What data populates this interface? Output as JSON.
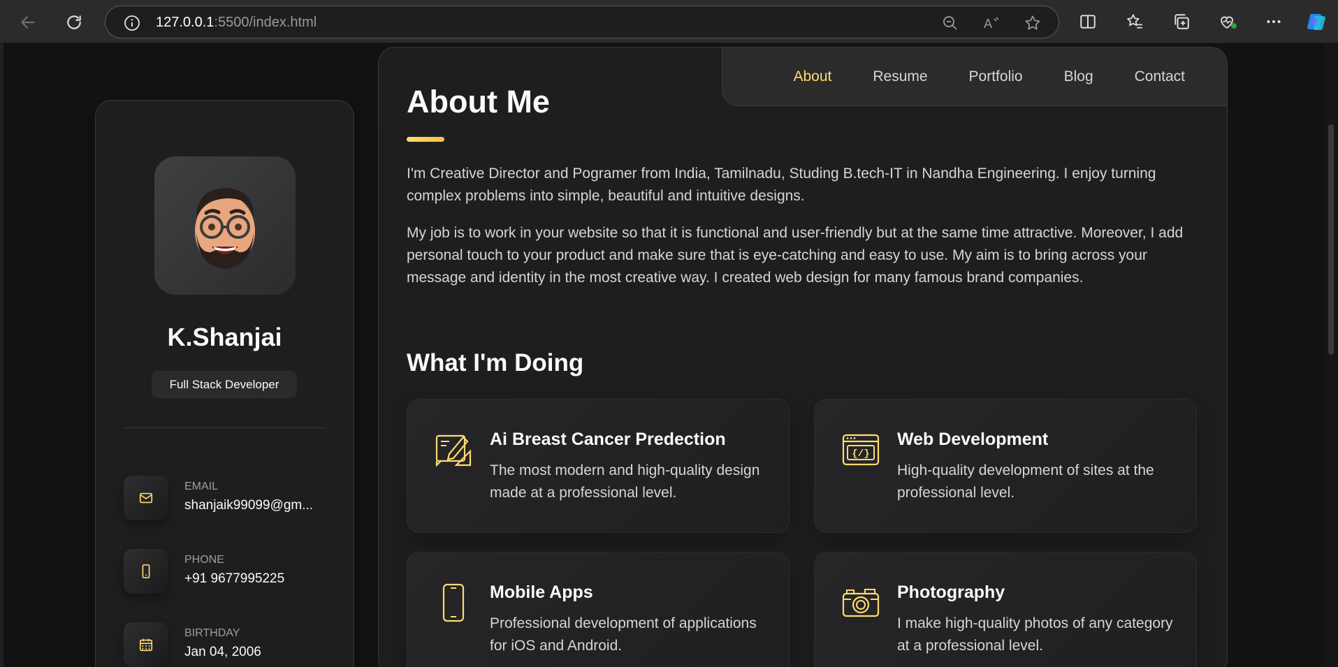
{
  "browser": {
    "url_host": "127.0.0.1",
    "url_path": ":5500/index.html"
  },
  "sidebar": {
    "name": "K.Shanjai",
    "title": "Full Stack Developer",
    "contacts": [
      {
        "label": "Email",
        "value": "shanjaik99099@gm...",
        "icon": "mail-icon"
      },
      {
        "label": "Phone",
        "value": "+91 9677995225",
        "icon": "phone-icon"
      },
      {
        "label": "Birthday",
        "value": "Jan 04, 2006",
        "icon": "calendar-icon"
      }
    ]
  },
  "nav": {
    "items": [
      "About",
      "Resume",
      "Portfolio",
      "Blog",
      "Contact"
    ],
    "active": "About"
  },
  "about": {
    "title": "About Me",
    "paragraph1": "I'm Creative Director and Pogramer from India, Tamilnadu, Studing B.tech-IT in Nandha Engineering. I enjoy turning complex problems into simple, beautiful and intuitive designs.",
    "paragraph2": "My job is to work in your website so that it is functional and user-friendly but at the same time attractive. Moreover, I add personal touch to your product and make sure that is eye-catching and easy to use. My aim is to bring across your message and identity in the most creative way. I created web design for many famous brand companies."
  },
  "services": {
    "title": "What I'm Doing",
    "items": [
      {
        "title": "Ai Breast Cancer Predection",
        "text": "The most modern and high-quality design made at a professional level.",
        "icon": "design-icon"
      },
      {
        "title": "Web Development",
        "text": "High-quality development of sites at the professional level.",
        "icon": "code-icon"
      },
      {
        "title": "Mobile Apps",
        "text": "Professional development of applications for iOS and Android.",
        "icon": "mobile-icon"
      },
      {
        "title": "Photography",
        "text": "I make high-quality photos of any category at a professional level.",
        "icon": "camera-icon"
      }
    ]
  },
  "colors": {
    "accent": "#ffdb70",
    "background": "#121212",
    "card": "#1e1e1f"
  }
}
